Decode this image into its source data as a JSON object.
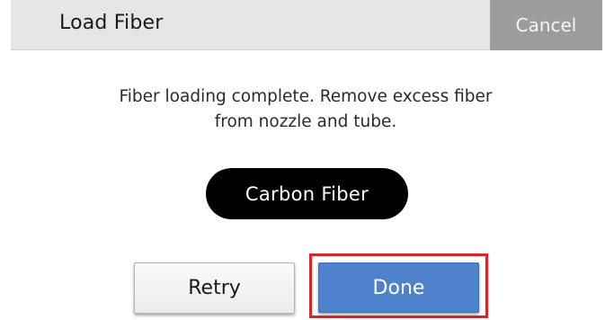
{
  "header": {
    "title": "Load Fiber",
    "cancel_label": "Cancel"
  },
  "message": {
    "line1": "Fiber loading complete. Remove excess fiber",
    "line2": "from nozzle and tube."
  },
  "material": {
    "label": "Carbon Fiber"
  },
  "actions": {
    "retry_label": "Retry",
    "done_label": "Done"
  },
  "colors": {
    "header_bg": "#e6e6e6",
    "cancel_bg": "#9c9c9c",
    "done_bg": "#4e82cc",
    "material_pill_bg": "#000000",
    "highlight": "#d8252a"
  }
}
